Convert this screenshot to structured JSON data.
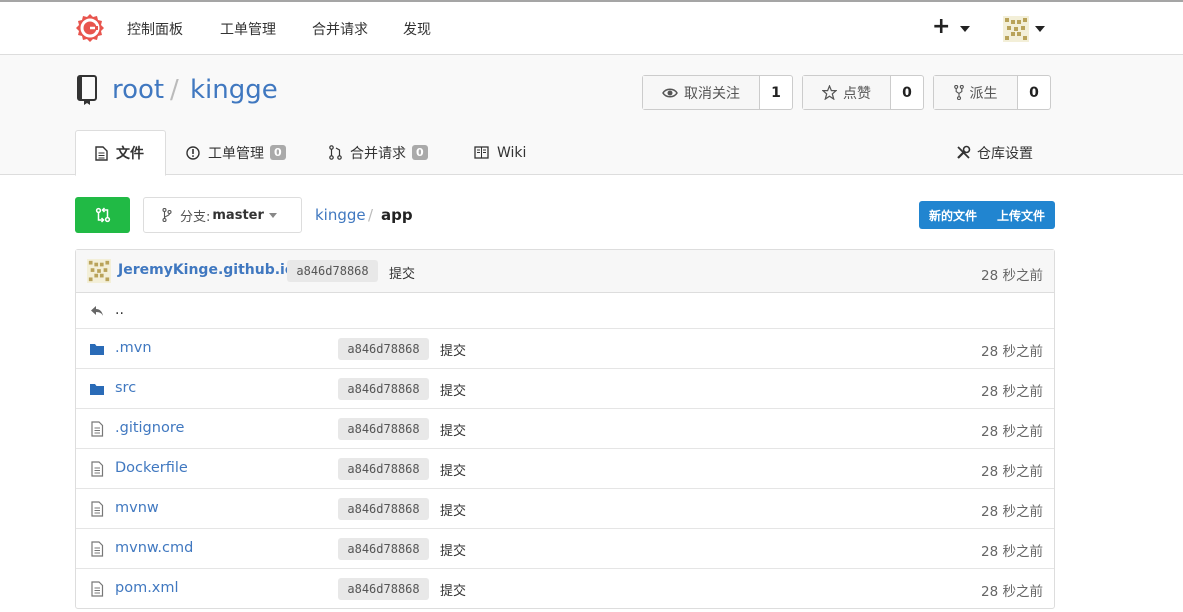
{
  "nav": {
    "items": [
      "控制面板",
      "工单管理",
      "合并请求",
      "发现"
    ],
    "plus_label": "+"
  },
  "repo": {
    "owner": "root",
    "separator": "/",
    "name": "kingge"
  },
  "actions": {
    "watch": {
      "label": "取消关注",
      "count": "1"
    },
    "star": {
      "label": "点赞",
      "count": "0"
    },
    "fork": {
      "label": "派生",
      "count": "0"
    }
  },
  "tabs": {
    "files": "文件",
    "issues": "工单管理",
    "issues_count": "0",
    "pulls": "合并请求",
    "pulls_count": "0",
    "wiki": "Wiki",
    "settings": "仓库设置"
  },
  "toolbar": {
    "branch_prefix": "分支:",
    "branch_name": "master",
    "path_root": "kingge",
    "path_sep": "/",
    "path_current": "app",
    "new_file": "新的文件",
    "upload_file": "上传文件"
  },
  "latest_commit": {
    "author": "JeremyKinge.github.io",
    "sha": "a846d78868",
    "message": "提交",
    "age": "28 秒之前"
  },
  "parent_dir": "..",
  "files": [
    {
      "name": ".mvn",
      "type": "folder",
      "sha": "a846d78868",
      "message": "提交",
      "age": "28 秒之前"
    },
    {
      "name": "src",
      "type": "folder",
      "sha": "a846d78868",
      "message": "提交",
      "age": "28 秒之前"
    },
    {
      "name": ".gitignore",
      "type": "file",
      "sha": "a846d78868",
      "message": "提交",
      "age": "28 秒之前"
    },
    {
      "name": "Dockerfile",
      "type": "file",
      "sha": "a846d78868",
      "message": "提交",
      "age": "28 秒之前"
    },
    {
      "name": "mvnw",
      "type": "file",
      "sha": "a846d78868",
      "message": "提交",
      "age": "28 秒之前"
    },
    {
      "name": "mvnw.cmd",
      "type": "file",
      "sha": "a846d78868",
      "message": "提交",
      "age": "28 秒之前"
    },
    {
      "name": "pom.xml",
      "type": "file",
      "sha": "a846d78868",
      "message": "提交",
      "age": "28 秒之前"
    }
  ],
  "colors": {
    "link": "#4078c0",
    "green": "#21ba45",
    "blue": "#2185d0",
    "logo": "#e8554e",
    "folder": "#2a6bb7"
  }
}
